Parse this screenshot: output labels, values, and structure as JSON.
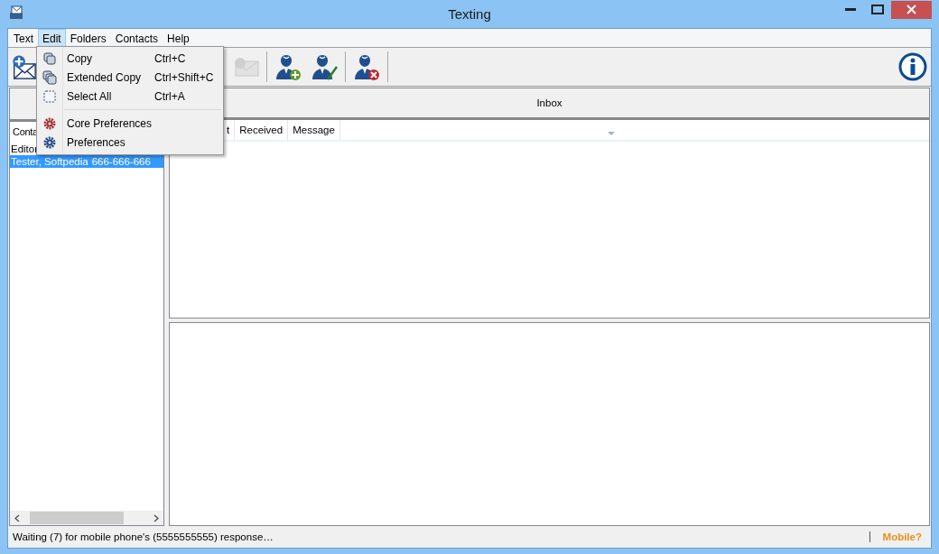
{
  "window": {
    "title": "Texting"
  },
  "menu_bar": [
    {
      "label": "Text",
      "selected": false
    },
    {
      "label": "Edit",
      "selected": true
    },
    {
      "label": "Folders",
      "selected": false
    },
    {
      "label": "Contacts",
      "selected": false
    },
    {
      "label": "Help",
      "selected": false
    }
  ],
  "toolbar": [
    {
      "kind": "new-message",
      "disabled": false
    },
    {
      "kind": "message",
      "disabled": true
    },
    {
      "kind": "add-contact",
      "disabled": false
    },
    {
      "kind": "edit-contact",
      "disabled": false
    },
    {
      "kind": "delete-contact",
      "disabled": false
    },
    {
      "kind": "info",
      "disabled": false
    }
  ],
  "edit_menu": [
    {
      "kind": "item",
      "label": "Copy",
      "shortcut": "Ctrl+C"
    },
    {
      "kind": "item",
      "label": "Extended Copy",
      "shortcut": "Ctrl+Shift+C"
    },
    {
      "kind": "item",
      "label": "Select All",
      "shortcut": "Ctrl+A"
    },
    {
      "kind": "separator"
    },
    {
      "kind": "item",
      "label": "Core Preferences"
    },
    {
      "kind": "item",
      "label": "Preferences"
    }
  ],
  "contacts": {
    "column": "Conta",
    "group": "Editor",
    "rows": [
      {
        "name": "Tester, Softpedia",
        "phone": "666-666-666",
        "selected": true
      }
    ]
  },
  "inbox": {
    "title": "Inbox",
    "columns": [
      "t",
      "Received",
      "Message"
    ]
  },
  "status_bar": {
    "message": "Waiting (7) for mobile phone's (5555555555) response…",
    "mobile": "Mobile?"
  }
}
